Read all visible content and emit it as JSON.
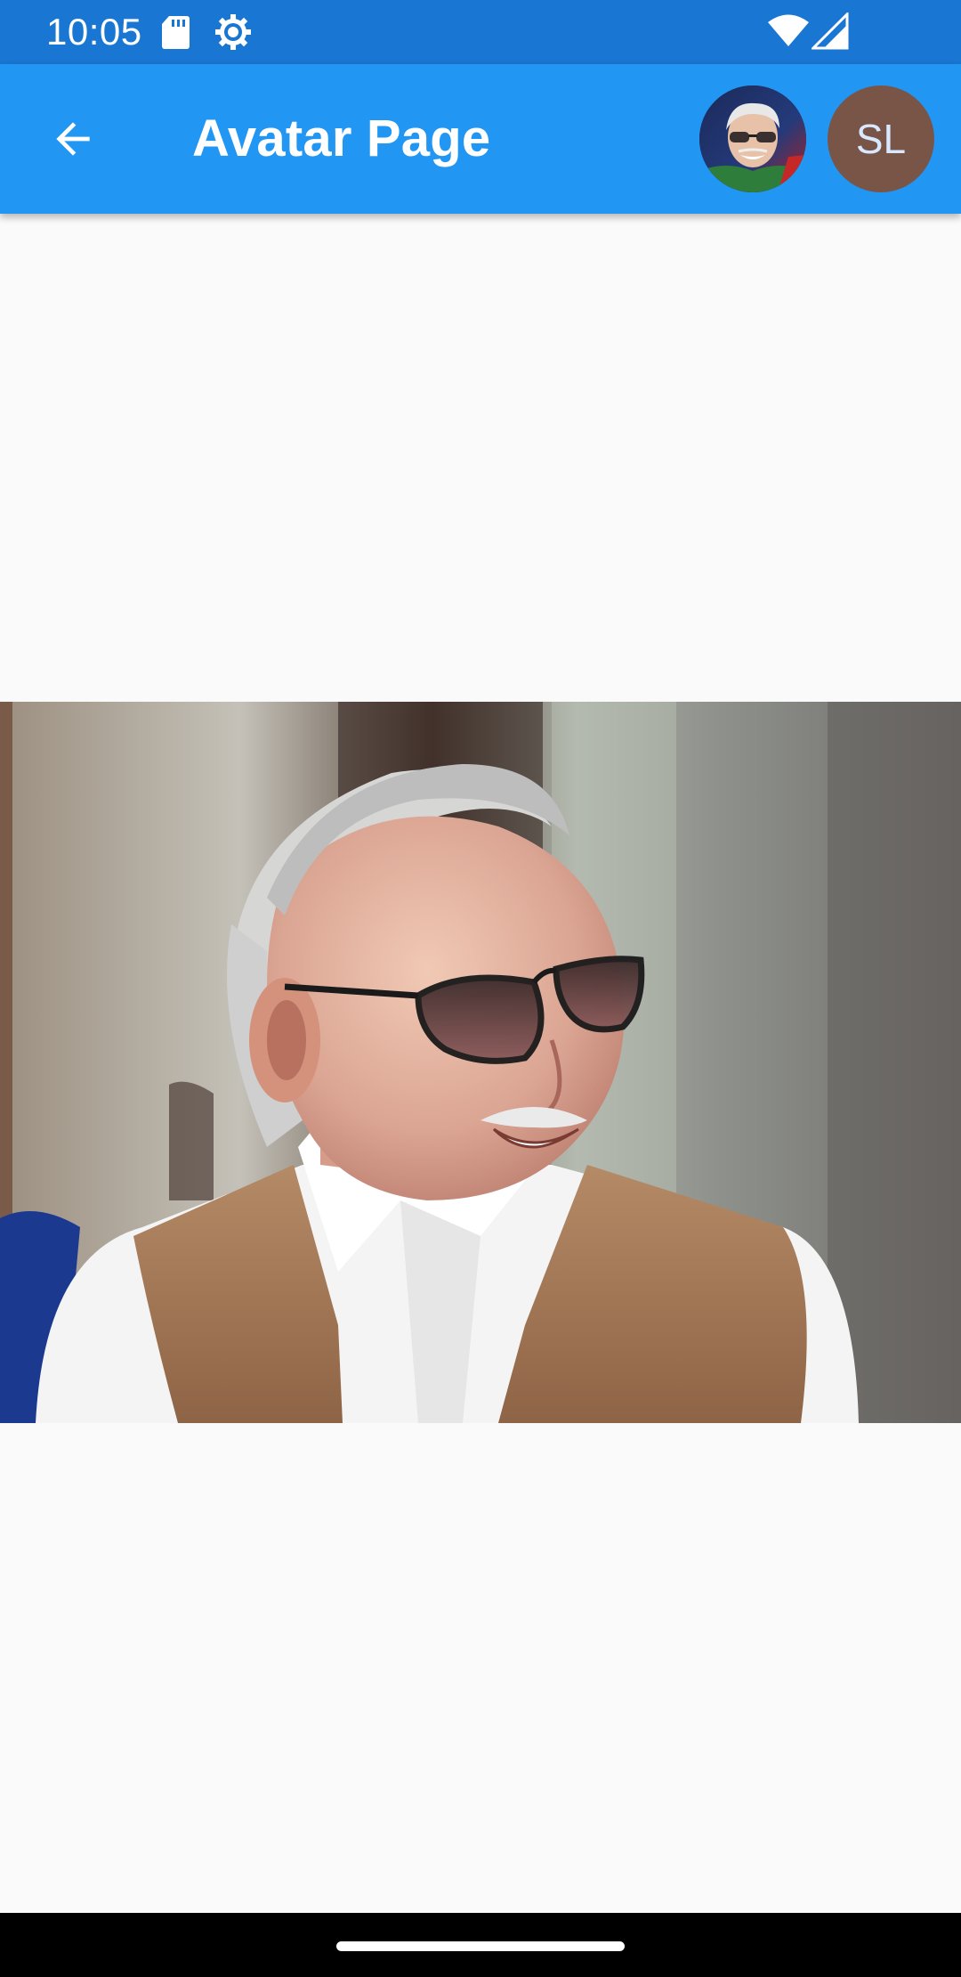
{
  "status_bar": {
    "time": "10:05",
    "icons": [
      "sd-card-icon",
      "settings-gear-icon",
      "wifi-icon",
      "cell-signal-icon"
    ],
    "background": "#1976d2"
  },
  "app_bar": {
    "title": "Avatar Page",
    "back_icon": "arrow-back-icon",
    "background": "#2196f3",
    "avatars": [
      {
        "type": "image"
      },
      {
        "type": "initials",
        "initials": "SL",
        "background": "#795548"
      }
    ]
  },
  "content": {
    "image": "portrait-photo",
    "background": "#fafafa"
  },
  "nav_bar": {
    "background": "#000000"
  }
}
